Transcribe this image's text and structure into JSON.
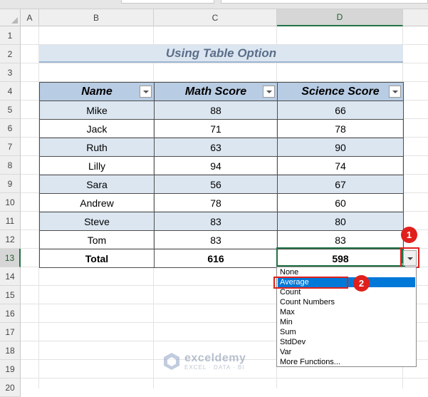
{
  "columns": [
    "A",
    "B",
    "C",
    "D"
  ],
  "rows": [
    "1",
    "2",
    "3",
    "4",
    "5",
    "6",
    "7",
    "8",
    "9",
    "10",
    "11",
    "12",
    "13",
    "14",
    "15",
    "16",
    "17",
    "18",
    "19",
    "20"
  ],
  "title": "Using Table Option",
  "table": {
    "headers": [
      "Name",
      "Math Score",
      "Science Score"
    ],
    "rows": [
      [
        "Mike",
        "88",
        "66"
      ],
      [
        "Jack",
        "71",
        "78"
      ],
      [
        "Ruth",
        "63",
        "90"
      ],
      [
        "Lilly",
        "94",
        "74"
      ],
      [
        "Sara",
        "56",
        "67"
      ],
      [
        "Andrew",
        "78",
        "60"
      ],
      [
        "Steve",
        "83",
        "80"
      ],
      [
        "Tom",
        "83",
        "83"
      ]
    ],
    "total": [
      "Total",
      "616",
      "598"
    ]
  },
  "dropdown_items": [
    "None",
    "Average",
    "Count",
    "Count Numbers",
    "Max",
    "Min",
    "Sum",
    "StdDev",
    "Var",
    "More Functions..."
  ],
  "dropdown_selected": "Average",
  "badges": [
    "1",
    "2"
  ],
  "watermark": {
    "name": "exceldemy",
    "tagline": "EXCEL · DATA · BI"
  },
  "colors": {
    "header_fill": "#b8cce4",
    "band_fill": "#dce6f1",
    "selection_green": "#217346",
    "highlight_blue": "#0078d7",
    "annotation_red": "#e0201c"
  },
  "icons": [
    "filter-dropdown-icon",
    "total-row-dropdown-icon",
    "exceldemy-logo-icon",
    "select-all-triangle-icon"
  ]
}
